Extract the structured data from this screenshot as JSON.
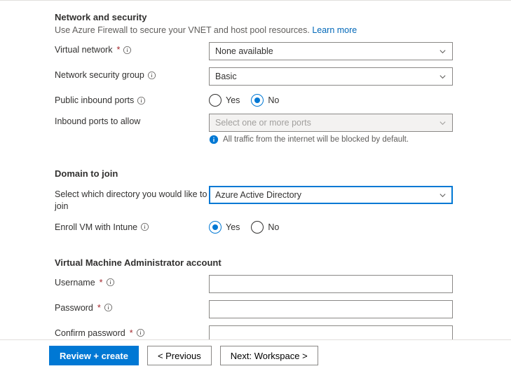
{
  "network": {
    "title": "Network and security",
    "description_prefix": "Use Azure Firewall to secure your VNET and host pool resources. ",
    "learn_more": "Learn more",
    "vnet": {
      "label": "Virtual network",
      "value": "None available"
    },
    "nsg": {
      "label": "Network security group",
      "value": "Basic"
    },
    "public_inbound": {
      "label": "Public inbound ports",
      "yes": "Yes",
      "no": "No",
      "selected": "no"
    },
    "inbound_ports": {
      "label": "Inbound ports to allow",
      "placeholder": "Select one or more ports",
      "hint": "All traffic from the internet will be blocked by default."
    }
  },
  "domain_join": {
    "title": "Domain to join",
    "directory": {
      "label": "Select which directory you would like to join",
      "value": "Azure Active Directory"
    },
    "intune": {
      "label": "Enroll VM with Intune",
      "yes": "Yes",
      "no": "No",
      "selected": "yes"
    }
  },
  "admin": {
    "title": "Virtual Machine Administrator account",
    "username_label": "Username",
    "password_label": "Password",
    "confirm_label": "Confirm password"
  },
  "footer": {
    "review": "Review + create",
    "previous": "<  Previous",
    "next": "Next: Workspace  >"
  }
}
